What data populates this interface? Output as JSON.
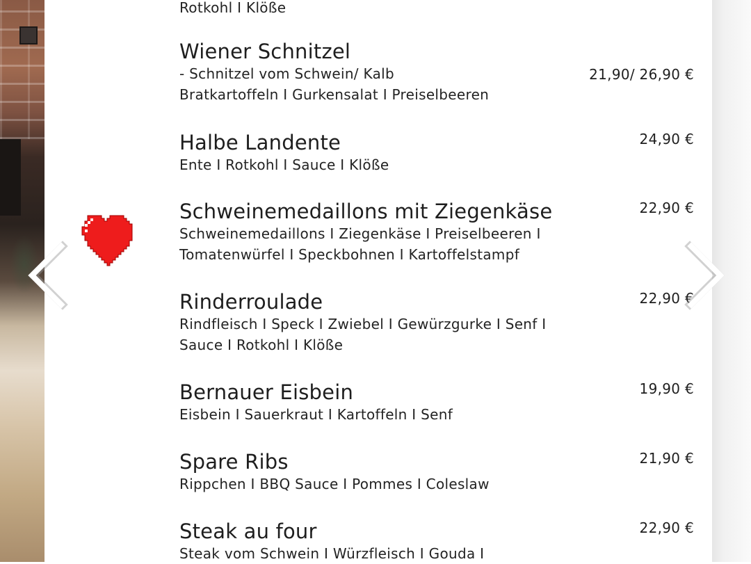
{
  "menu": {
    "partial_top": "Rotkohl I Klöße",
    "items": [
      {
        "name": "Wiener Schnitzel",
        "lines": [
          "- Schnitzel vom Schwein/ Kalb",
          "Bratkartoffeln I Gurkensalat I Preiselbeeren"
        ],
        "price": "21,90/ 26,90 €"
      },
      {
        "name": "Halbe Landente",
        "lines": [
          "Ente I Rotkohl I Sauce I Klöße"
        ],
        "price": "24,90 €"
      },
      {
        "name": "Schweinemedaillons mit Ziegenkäse",
        "lines": [
          "Schweinemedaillons I Ziegenkäse I Preiselbeeren I",
          "Tomatenwürfel I Speckbohnen I Kartoffelstampf"
        ],
        "price": "22,90 €"
      },
      {
        "name": "Rinderroulade",
        "lines": [
          "Rindfleisch I Speck I Zwiebel I Gewürzgurke I Senf I",
          "Sauce I Rotkohl I Klöße"
        ],
        "price": "22,90 €"
      },
      {
        "name": "Bernauer Eisbein",
        "lines": [
          "Eisbein I Sauerkraut I Kartoffeln I Senf"
        ],
        "price": "19,90 €"
      },
      {
        "name": "Spare Ribs",
        "lines": [
          "Rippchen I BBQ Sauce I Pommes I Coleslaw"
        ],
        "price": "21,90 €"
      },
      {
        "name": "Steak au four",
        "lines": [
          "Steak vom Schwein I Würzfleisch I Gouda I"
        ],
        "price": "22,90 €"
      }
    ]
  },
  "icons": {
    "prev": "chevron-left-icon",
    "next": "chevron-right-icon",
    "like": "heart-icon"
  },
  "colors": {
    "heart": "#ee1c1c",
    "text": "#1e1e1e",
    "arrow": "#ffffff"
  }
}
